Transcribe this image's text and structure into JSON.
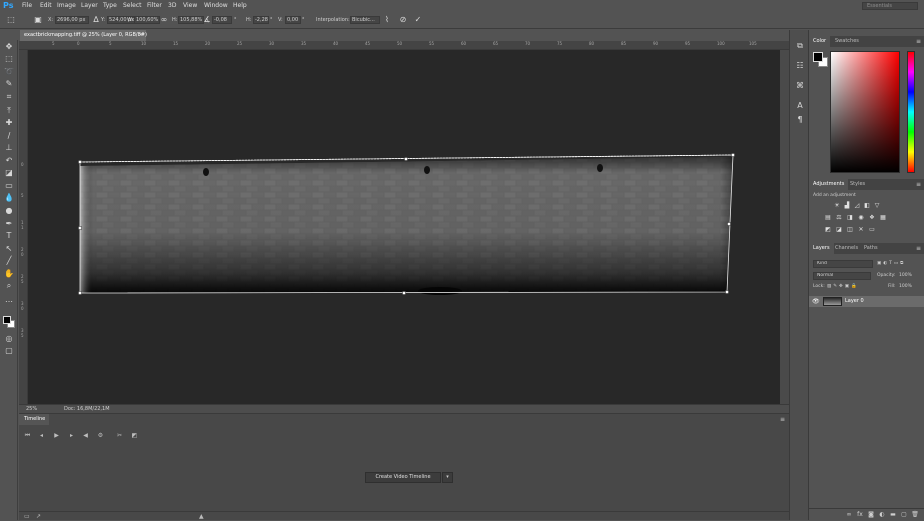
{
  "app": {
    "logo": "Ps"
  },
  "menu": [
    "File",
    "Edit",
    "Image",
    "Layer",
    "Type",
    "Select",
    "Filter",
    "3D",
    "View",
    "Window",
    "Help"
  ],
  "workspace_search": "Essentials",
  "options": {
    "x_label": "X:",
    "x_value": "2696,00 px",
    "y_label": "Y:",
    "y_value": "524,00 px",
    "w_label": "W:",
    "w_value": "100,60%",
    "h_label": "H:",
    "h_value": "105,88%",
    "angle_value": "-0,08",
    "h_skew_label": "H:",
    "h_skew_value": "-2,28",
    "v_skew_label": "V:",
    "v_skew_value": "0,00",
    "interpolation_label": "Interpolation:",
    "interpolation_value": "Bicubic..."
  },
  "document": {
    "tab_title": "exactbrickmapping.tiff @ 25% (Layer 0, RGB/8#)",
    "close": "×"
  },
  "ruler": {
    "h_ticks": [
      "5",
      "0",
      "5",
      "10",
      "15",
      "20",
      "25",
      "30",
      "35",
      "40",
      "45",
      "50",
      "55",
      "60",
      "65",
      "70",
      "75",
      "80",
      "85",
      "90",
      "95",
      "100",
      "105"
    ],
    "v_ticks": [
      "0",
      "5",
      "1",
      "1",
      "2",
      "0",
      "2",
      "5",
      "3",
      "0",
      "3",
      "5"
    ]
  },
  "status": {
    "zoom": "25%",
    "doc": "Doc: 16,8M/22,1M"
  },
  "timeline": {
    "tab": "Timeline",
    "create_button": "Create Video Timeline"
  },
  "panels": {
    "color_tab": "Color",
    "swatches_tab": "Swatches",
    "adjustments_tab": "Adjustments",
    "styles_tab": "Styles",
    "adjustments_hint": "Add an adjustment",
    "layers_tab": "Layers",
    "channels_tab": "Channels",
    "paths_tab": "Paths",
    "kind_filter": "Kind",
    "blend_mode": "Normal",
    "opacity_label": "Opacity:",
    "opacity_value": "100%",
    "lock_label": "Lock:",
    "fill_label": "Fill:",
    "fill_value": "100%",
    "layer_name": "Layer 0"
  },
  "colors": {
    "accent": "#31a8ff",
    "chrome": "#535353",
    "canvas_bg": "#282828"
  }
}
